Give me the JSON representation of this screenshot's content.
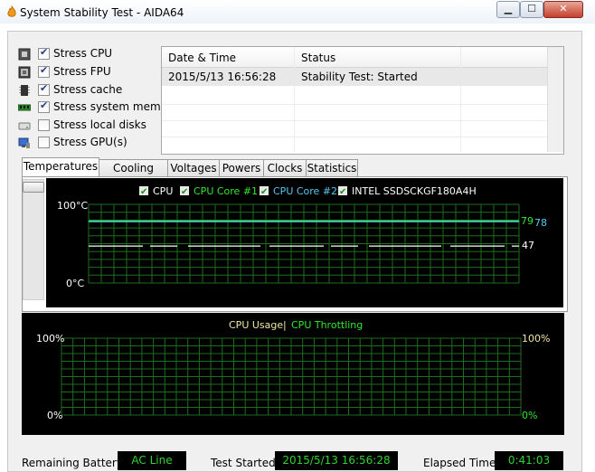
{
  "window": {
    "title": "System Stability Test - AIDA64",
    "icon": "flame-icon",
    "controls": {
      "minimize_icon": "minimize-icon",
      "maximize_icon": "maximize-icon",
      "close_icon": "close-icon"
    }
  },
  "stress_options": [
    {
      "label": "Stress CPU",
      "checked": true,
      "icon": "cpu-icon"
    },
    {
      "label": "Stress FPU",
      "checked": true,
      "icon": "fpu-icon"
    },
    {
      "label": "Stress cache",
      "checked": true,
      "icon": "cache-icon"
    },
    {
      "label": "Stress system memory",
      "checked": true,
      "icon": "memory-icon"
    },
    {
      "label": "Stress local disks",
      "checked": false,
      "icon": "disk-icon"
    },
    {
      "label": "Stress GPU(s)",
      "checked": false,
      "icon": "gpu-icon"
    }
  ],
  "log": {
    "columns": [
      "Date & Time",
      "Status"
    ],
    "rows": [
      {
        "datetime": "2015/5/13 16:56:28",
        "status": "Stability Test: Started"
      }
    ]
  },
  "tabs": [
    {
      "label": "Temperatures",
      "active": true
    },
    {
      "label": "Cooling Fans",
      "active": false
    },
    {
      "label": "Voltages",
      "active": false
    },
    {
      "label": "Powers",
      "active": false
    },
    {
      "label": "Clocks",
      "active": false
    },
    {
      "label": "Statistics",
      "active": false
    }
  ],
  "temperature_graph": {
    "legend": [
      {
        "label": "CPU",
        "checked": true,
        "color": "#ffffff"
      },
      {
        "label": "CPU Core #1",
        "checked": true,
        "color": "#2ee82e"
      },
      {
        "label": "CPU Core #2",
        "checked": true,
        "color": "#57c8f0"
      },
      {
        "label": "INTEL SSDSCKGF180A4H",
        "checked": true,
        "color": "#ffffff"
      }
    ],
    "y_max_label": "100°C",
    "y_min_label": "0°C",
    "value_labels": [
      "79",
      "78",
      "47"
    ],
    "value_colors": [
      "#2ee82e",
      "#57c8f0",
      "#ffffff"
    ]
  },
  "chart_data": {
    "type": "line",
    "ylim": [
      0,
      100
    ],
    "series": [
      {
        "name": "CPU Core #1",
        "values": [
          79,
          79,
          79,
          79,
          79,
          79,
          79,
          79,
          79,
          79
        ]
      },
      {
        "name": "CPU Core #2",
        "values": [
          78,
          78,
          78,
          78,
          78,
          78,
          78,
          78,
          78,
          78
        ]
      },
      {
        "name": "INTEL SSDSCKGF180A4H",
        "values": [
          47,
          47,
          47,
          47,
          47,
          47,
          47,
          47,
          47,
          47
        ]
      }
    ]
  },
  "usage_graph": {
    "title_left": "CPU Usage",
    "separator": "|",
    "title_right": "CPU Throttling",
    "left_max": "100%",
    "left_min": "0%",
    "right_max": "100%",
    "right_min": "0%",
    "title_left_color": "#f0e6a0",
    "title_right_color": "#2ee82e"
  },
  "status_bar": {
    "battery_label": "Remaining Battery:",
    "battery_value": "AC Line",
    "started_label": "Test Started:",
    "started_value": "2015/5/13 16:56:28",
    "elapsed_label": "Elapsed Time:",
    "elapsed_value": "0:41:03"
  }
}
